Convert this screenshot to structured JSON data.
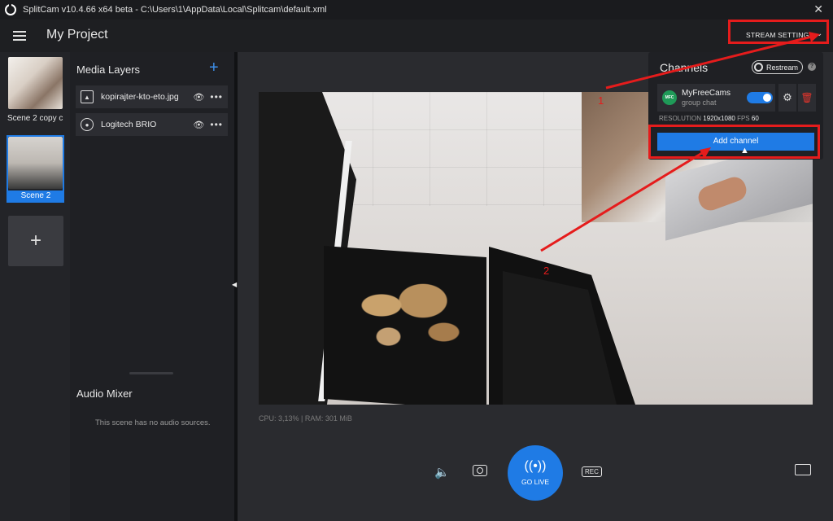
{
  "window": {
    "title": "SplitCam v10.4.66 x64 beta - C:\\Users\\1\\AppData\\Local\\Splitcam\\default.xml",
    "close_glyph": "✕"
  },
  "header": {
    "menu_icon": "hamburger-menu-icon",
    "project_title": "My Project",
    "stream_settings_label": "STREAM SETTINGS"
  },
  "scenes": {
    "items": [
      {
        "label": "Scene 2 copy c",
        "selected": false
      },
      {
        "label": "Scene 2",
        "selected": true
      }
    ],
    "add_glyph": "+"
  },
  "media_layers": {
    "title": "Media Layers",
    "add_glyph": "+",
    "items": [
      {
        "name": "kopirajter-kto-eto.jpg",
        "type": "image",
        "visible": true
      },
      {
        "name": "Logitech BRIO",
        "type": "camera",
        "visible": true
      }
    ]
  },
  "audio_mixer": {
    "title": "Audio Mixer",
    "empty_text": "This scene has no audio sources."
  },
  "status": {
    "cpu_ram": "CPU: 3,13% | RAM: 301 MiB"
  },
  "controls": {
    "go_live_label": "GO LIVE",
    "rec_label": "REC"
  },
  "channels": {
    "title": "Channels",
    "restream_label": "Restream",
    "help_glyph": "?",
    "items": [
      {
        "name": "MyFreeCams",
        "subtitle": "group chat",
        "logo_text": "MFC",
        "enabled": true
      }
    ],
    "resolution_label": "RESOLUTION",
    "resolution_value": "1920x1080",
    "fps_label": "FPS",
    "fps_value": "60",
    "add_channel_label": "Add channel"
  },
  "annotations": {
    "num1": "1",
    "num2": "2",
    "color": "#e51c1c"
  },
  "colors": {
    "accent": "#1f7be5",
    "background": "#1e1f22",
    "delete": "#e5352c"
  }
}
